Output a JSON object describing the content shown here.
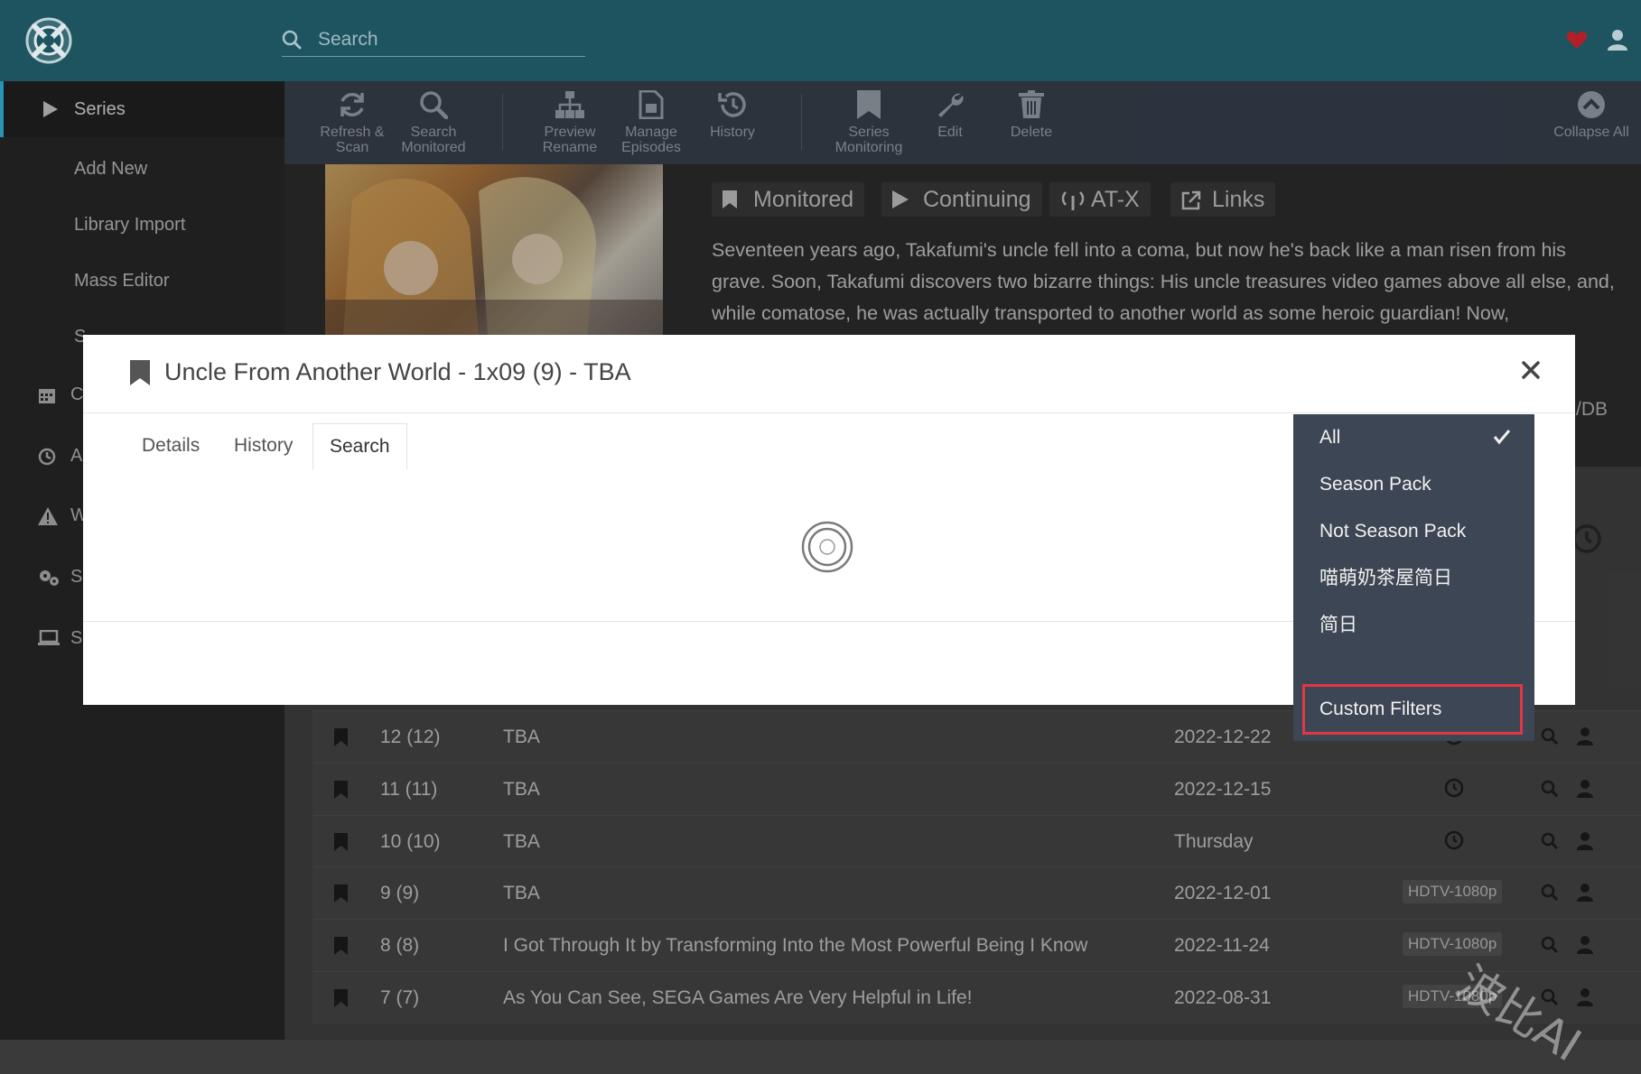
{
  "header": {
    "search_placeholder": "Search"
  },
  "sidebar": {
    "series_label": "Series",
    "sub_items": [
      "Add New",
      "Library Import",
      "Mass Editor",
      "S"
    ],
    "other_letters": [
      "C",
      "A",
      "W",
      "S",
      "S"
    ]
  },
  "toolbar": {
    "buttons": [
      {
        "label": "Refresh & Scan",
        "icon": "refresh-icon"
      },
      {
        "label": "Search Monitored",
        "icon": "search-icon"
      },
      {
        "label": "Preview Rename",
        "icon": "sitemap-icon"
      },
      {
        "label": "Manage Episodes",
        "icon": "file-icon"
      },
      {
        "label": "History",
        "icon": "history-icon"
      },
      {
        "label": "Series Monitoring",
        "icon": "bookmark-icon"
      },
      {
        "label": "Edit",
        "icon": "wrench-icon"
      },
      {
        "label": "Delete",
        "icon": "trash-icon"
      },
      {
        "label": "Collapse All",
        "icon": "chevron-up-circle-icon"
      }
    ]
  },
  "series": {
    "tags": {
      "monitored": "Monitored",
      "status": "Continuing",
      "network": "AT-X",
      "links": "Links"
    },
    "overview": "Seventeen years ago, Takafumi's uncle fell into a coma, but now he's back like a man risen from his grave. Soon, Takafumi discovers two bizarre things: His uncle treasures video games above all else, and, while comatose, he was actually transported to another world as some heroic guardian! Now,",
    "edge_text": "/DB"
  },
  "episodes": [
    {
      "num": "12 (12)",
      "title": "TBA",
      "date": "2022-12-22",
      "quality": ""
    },
    {
      "num": "11 (11)",
      "title": "TBA",
      "date": "2022-12-15",
      "quality": ""
    },
    {
      "num": "10 (10)",
      "title": "TBA",
      "date": "Thursday",
      "quality": ""
    },
    {
      "num": "9 (9)",
      "title": "TBA",
      "date": "2022-12-01",
      "quality": "HDTV-1080p"
    },
    {
      "num": "8 (8)",
      "title": "I Got Through It by Transforming Into the Most Powerful Being I Know",
      "date": "2022-11-24",
      "quality": "HDTV-1080p"
    },
    {
      "num": "7 (7)",
      "title": "As You Can See, SEGA Games Are Very Helpful in Life!",
      "date": "2022-08-31",
      "quality": "HDTV-1080p"
    }
  ],
  "modal": {
    "title": "Uncle From Another World - 1x09 (9) - TBA",
    "tabs": {
      "details": "Details",
      "history": "History",
      "search": "Search"
    },
    "active_tab": "Search"
  },
  "filter_menu": {
    "items": [
      "All",
      "Season Pack",
      "Not Season Pack",
      "喵萌奶茶屋简日",
      "简日",
      "Custom Filters"
    ],
    "selected": "All",
    "highlighted": "Custom Filters",
    "highlight_color": "#e33645"
  },
  "watermark": "波比AI",
  "colors": {
    "header": "#1e5460",
    "accent": "#35c5f4",
    "toolbar": "#3d4654"
  }
}
